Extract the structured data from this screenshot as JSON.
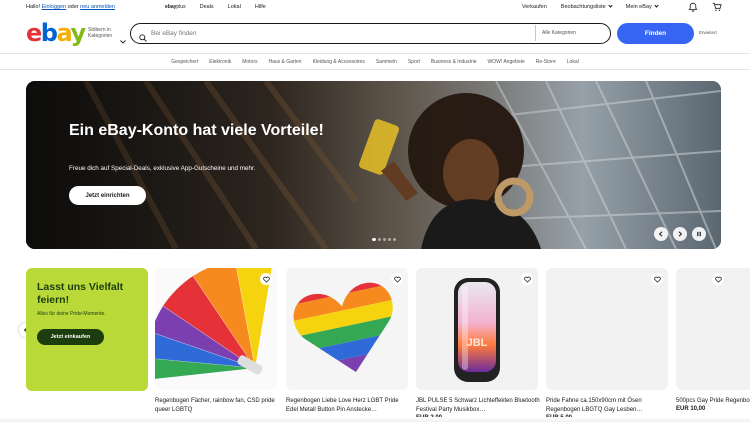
{
  "topbar": {
    "greeting": "Hallo!",
    "login": "Einloggen",
    "or": "oder",
    "register": "neu anmelden",
    "ebayplus_bold": "ebay",
    "ebayplus_rest": "plus",
    "deals": "Deals",
    "lokal": "Lokal",
    "help": "Hilfe",
    "sell": "Verkaufen",
    "watchlist": "Beobachtungsliste",
    "myebay": "Mein eBay",
    "bell_icon": "bell-icon",
    "cart_icon": "cart-icon"
  },
  "header": {
    "logo": {
      "e": "e",
      "b": "b",
      "a": "a",
      "y": "y"
    },
    "browse": "Stöbern in Kategorien",
    "search_placeholder": "Bei eBay finden",
    "category_select": "Alle Kategorien",
    "search_button": "Finden",
    "advanced": "Erweitert"
  },
  "nav": {
    "items": [
      "Gespeichert",
      "Elektronik",
      "Motors",
      "Haus & Garten",
      "Kleidung & Accessoires",
      "Sammeln",
      "Sport",
      "Business & Industrie",
      "WOW! Angebote",
      "Re-Store",
      "Lokal"
    ]
  },
  "hero": {
    "title": "Ein eBay-Konto hat viele Vorteile!",
    "subtitle": "Freue dich auf Special-Deals, exklusive App-Gutscheine und mehr.",
    "cta": "Jetzt einrichten",
    "slide_count": 5,
    "active_slide": 0
  },
  "promo": {
    "title": "Lasst uns Vielfalt feiern!",
    "text": "Alles für deine Pride-Momente.",
    "button": "Jetzt einkaufen"
  },
  "products": [
    {
      "title": "Regenbogen Fächer, rainbow fan, CSD pride queer LGBTQ",
      "price": ""
    },
    {
      "title": "Regenbogen Liebe Love Herz LGBT Pride Edel Metall Button Pin Anstecke…",
      "price": ""
    },
    {
      "title": "JBL PULSE 5 Schwarz Lichteffekten Bluetooth Festival Party Musikbox…",
      "price": "EUR 2,00"
    },
    {
      "title": "Pride Fahne ca.150x90cm mit Ösen Regenbogen LBGTQ Gay Lesben…",
      "price": "EUR 5,00"
    },
    {
      "title": "500pcs Gay Pride Regenbogen…",
      "price": "EUR 10,00"
    }
  ],
  "colors": {
    "accent": "#3665f3",
    "promo_bg": "#b8d937",
    "promo_dark": "#1c3d0c",
    "link": "#0654ba"
  }
}
